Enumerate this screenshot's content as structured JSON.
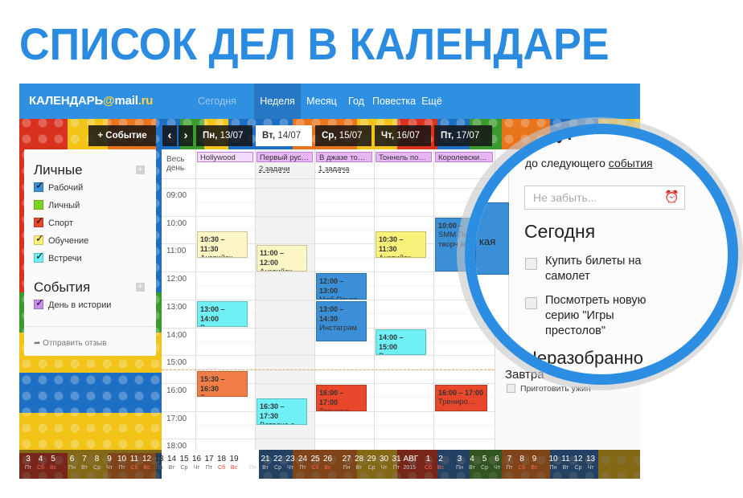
{
  "headline": "СПИСОК ДЕЛ В КАЛЕНДАРЕ",
  "topbar": {
    "logo_text": "КАЛЕНДАРЬ",
    "logo_at": "@",
    "logo_mail": "mail",
    "logo_ru": ".ru",
    "today": "Сегодня",
    "views": [
      "Неделя",
      "Месяц",
      "Год",
      "Повестка",
      "Ещё"
    ],
    "active_view": "Неделя"
  },
  "toolbar": {
    "new_event": "+ Событие",
    "prev": "‹",
    "next": "›"
  },
  "days": [
    {
      "dow": "Пн,",
      "date": "13/07"
    },
    {
      "dow": "Вт,",
      "date": "14/07",
      "today": true
    },
    {
      "dow": "Ср,",
      "date": "15/07"
    },
    {
      "dow": "Чт,",
      "date": "16/07"
    },
    {
      "dow": "Пт,",
      "date": "17/07"
    }
  ],
  "sidebar": {
    "personal_title": "Личные",
    "calendars": [
      {
        "label": "Рабочий",
        "color": "#3a8fd6",
        "checked": true
      },
      {
        "label": "Личный",
        "color": "#7ed321",
        "checked": false
      },
      {
        "label": "Спорт",
        "color": "#e8472b",
        "checked": true
      },
      {
        "label": "Обучение",
        "color": "#f8f27a",
        "checked": true
      },
      {
        "label": "Встречи",
        "color": "#6ff0f5",
        "checked": true
      }
    ],
    "events_title": "События",
    "event_calendars": [
      {
        "label": "День в истории",
        "color": "#c98ef0",
        "checked": true
      }
    ],
    "feedback": "Отправить отзыв"
  },
  "grid": {
    "allday_label_1": "Весь",
    "allday_label_2": "день",
    "allday": [
      "Hollywood",
      "Первый рус…",
      "В джазе то…",
      "Тоннель по…",
      "Королевски…"
    ],
    "tasks": [
      "",
      "2 задачи",
      "1 задача",
      "",
      ""
    ],
    "hours": [
      "09:00",
      "10:00",
      "11:00",
      "12:00",
      "13:00",
      "14:00",
      "15:00",
      "16:00",
      "17:00",
      "18:00"
    ],
    "now": "15:30",
    "events": [
      {
        "day": 0,
        "time": "10:30 – 11:30",
        "start": 10.5,
        "end": 11.5,
        "title": "Английск…",
        "color": "#fbf6c4"
      },
      {
        "day": 1,
        "time": "11:00 – 12:00",
        "start": 11,
        "end": 12,
        "title": "Английск…",
        "color": "#fbf6c4"
      },
      {
        "day": 2,
        "time": "12:00 – 13:00",
        "start": 12,
        "end": 13,
        "title": "Моб.Почта",
        "color": "#3a8fd6"
      },
      {
        "day": 3,
        "time": "10:30 – 11:30",
        "start": 10.5,
        "end": 11.5,
        "title": "Английск…",
        "color": "#f8f27a"
      },
      {
        "day": 4,
        "time": "10:00 –",
        "start": 10,
        "end": 12,
        "title": "SMM Пятни творч встре",
        "color": "#3a8fd6"
      },
      {
        "day": 0,
        "time": "13:00 – 14:00",
        "start": 13,
        "end": 14,
        "title": "Встреча",
        "color": "#6ff0f5"
      },
      {
        "day": 2,
        "time": "13:00 – 14:30",
        "start": 13,
        "end": 14.5,
        "title": "Инстаграм",
        "color": "#3a8fd6"
      },
      {
        "day": 3,
        "time": "14:00 – 15:00",
        "start": 14,
        "end": 15,
        "title": "Встреча",
        "color": "#6ff0f5"
      },
      {
        "day": 0,
        "time": "15:30 – 16:30",
        "start": 15.5,
        "end": 16.5,
        "title": "Трениро…",
        "color": "#ef7d45"
      },
      {
        "day": 1,
        "time": "16:30 – 17:30",
        "start": 16.5,
        "end": 17.5,
        "title": "Встреча с",
        "color": "#6ff0f5"
      },
      {
        "day": 2,
        "time": "16:00 – 17:00",
        "start": 16,
        "end": 17,
        "title": "Трениро…",
        "color": "#e8472b"
      },
      {
        "day": 4,
        "time": "16:00 – 17:00",
        "start": 16,
        "end": 17,
        "title": "Трениро…",
        "color": "#e8472b"
      }
    ]
  },
  "right_panel": {
    "minutes_partial": "минут",
    "until_next": "до следующего",
    "next_event_link": "события",
    "todo_placeholder": "Не забыть...",
    "today_title": "Сегодня",
    "today_tasks": [
      [
        "Купить билеты на",
        "самолет"
      ],
      [
        "Посмотреть новую",
        "серию \"Игры",
        "престолов\""
      ]
    ],
    "unsorted_title": "Неразобранно",
    "tomorrow_title": "Завтра",
    "tomorrow_tasks": [
      "Приготовить ужин"
    ],
    "cut_text": "кая"
  },
  "minical": [
    {
      "d": "3",
      "w": "Пт"
    },
    {
      "d": "4",
      "w": "Сб",
      "we": true
    },
    {
      "d": "5",
      "w": "Вс",
      "we": true
    },
    {
      "d": "6",
      "w": "Пн",
      "gap": true
    },
    {
      "d": "7",
      "w": "Вт"
    },
    {
      "d": "8",
      "w": "Ср"
    },
    {
      "d": "9",
      "w": "Чт"
    },
    {
      "d": "10",
      "w": "Пт"
    },
    {
      "d": "11",
      "w": "Сб",
      "we": true
    },
    {
      "d": "12",
      "w": "Вс",
      "we": true
    },
    {
      "d": "13",
      "w": "Пн",
      "cur": true
    },
    {
      "d": "14",
      "w": "Вт",
      "cur": true
    },
    {
      "d": "15",
      "w": "Ср",
      "cur": true
    },
    {
      "d": "16",
      "w": "Чт",
      "cur": true
    },
    {
      "d": "17",
      "w": "Пт",
      "cur": true
    },
    {
      "d": "18",
      "w": "Сб",
      "we": true,
      "cur": true
    },
    {
      "d": "19",
      "w": "Вс",
      "we": true,
      "cur": true
    },
    {
      "d": "20",
      "w": "Пн",
      "gap": true
    },
    {
      "d": "21",
      "w": "Вт"
    },
    {
      "d": "22",
      "w": "Ср"
    },
    {
      "d": "23",
      "w": "Чт"
    },
    {
      "d": "24",
      "w": "Пт"
    },
    {
      "d": "25",
      "w": "Сб",
      "we": true
    },
    {
      "d": "26",
      "w": "Вс",
      "we": true
    },
    {
      "d": "27",
      "w": "Пн",
      "gap": true
    },
    {
      "d": "28",
      "w": "Вт"
    },
    {
      "d": "29",
      "w": "Ср"
    },
    {
      "d": "30",
      "w": "Чт"
    },
    {
      "d": "31",
      "w": "Пт"
    },
    {
      "d": "АВГ",
      "w": "2015"
    },
    {
      "d": "1",
      "w": "Сб",
      "we": true
    },
    {
      "d": "2",
      "w": "Вс",
      "we": true
    },
    {
      "d": "3",
      "w": "Пн",
      "gap": true
    },
    {
      "d": "4",
      "w": "Вт"
    },
    {
      "d": "5",
      "w": "Ср"
    },
    {
      "d": "6",
      "w": "Чт"
    },
    {
      "d": "7",
      "w": "Пт"
    },
    {
      "d": "8",
      "w": "Сб",
      "we": true
    },
    {
      "d": "9",
      "w": "Вс",
      "we": true
    },
    {
      "d": "10",
      "w": "Пн",
      "gap": true
    },
    {
      "d": "11",
      "w": "Вт"
    },
    {
      "d": "12",
      "w": "Ср"
    },
    {
      "d": "13",
      "w": "Чт"
    }
  ]
}
